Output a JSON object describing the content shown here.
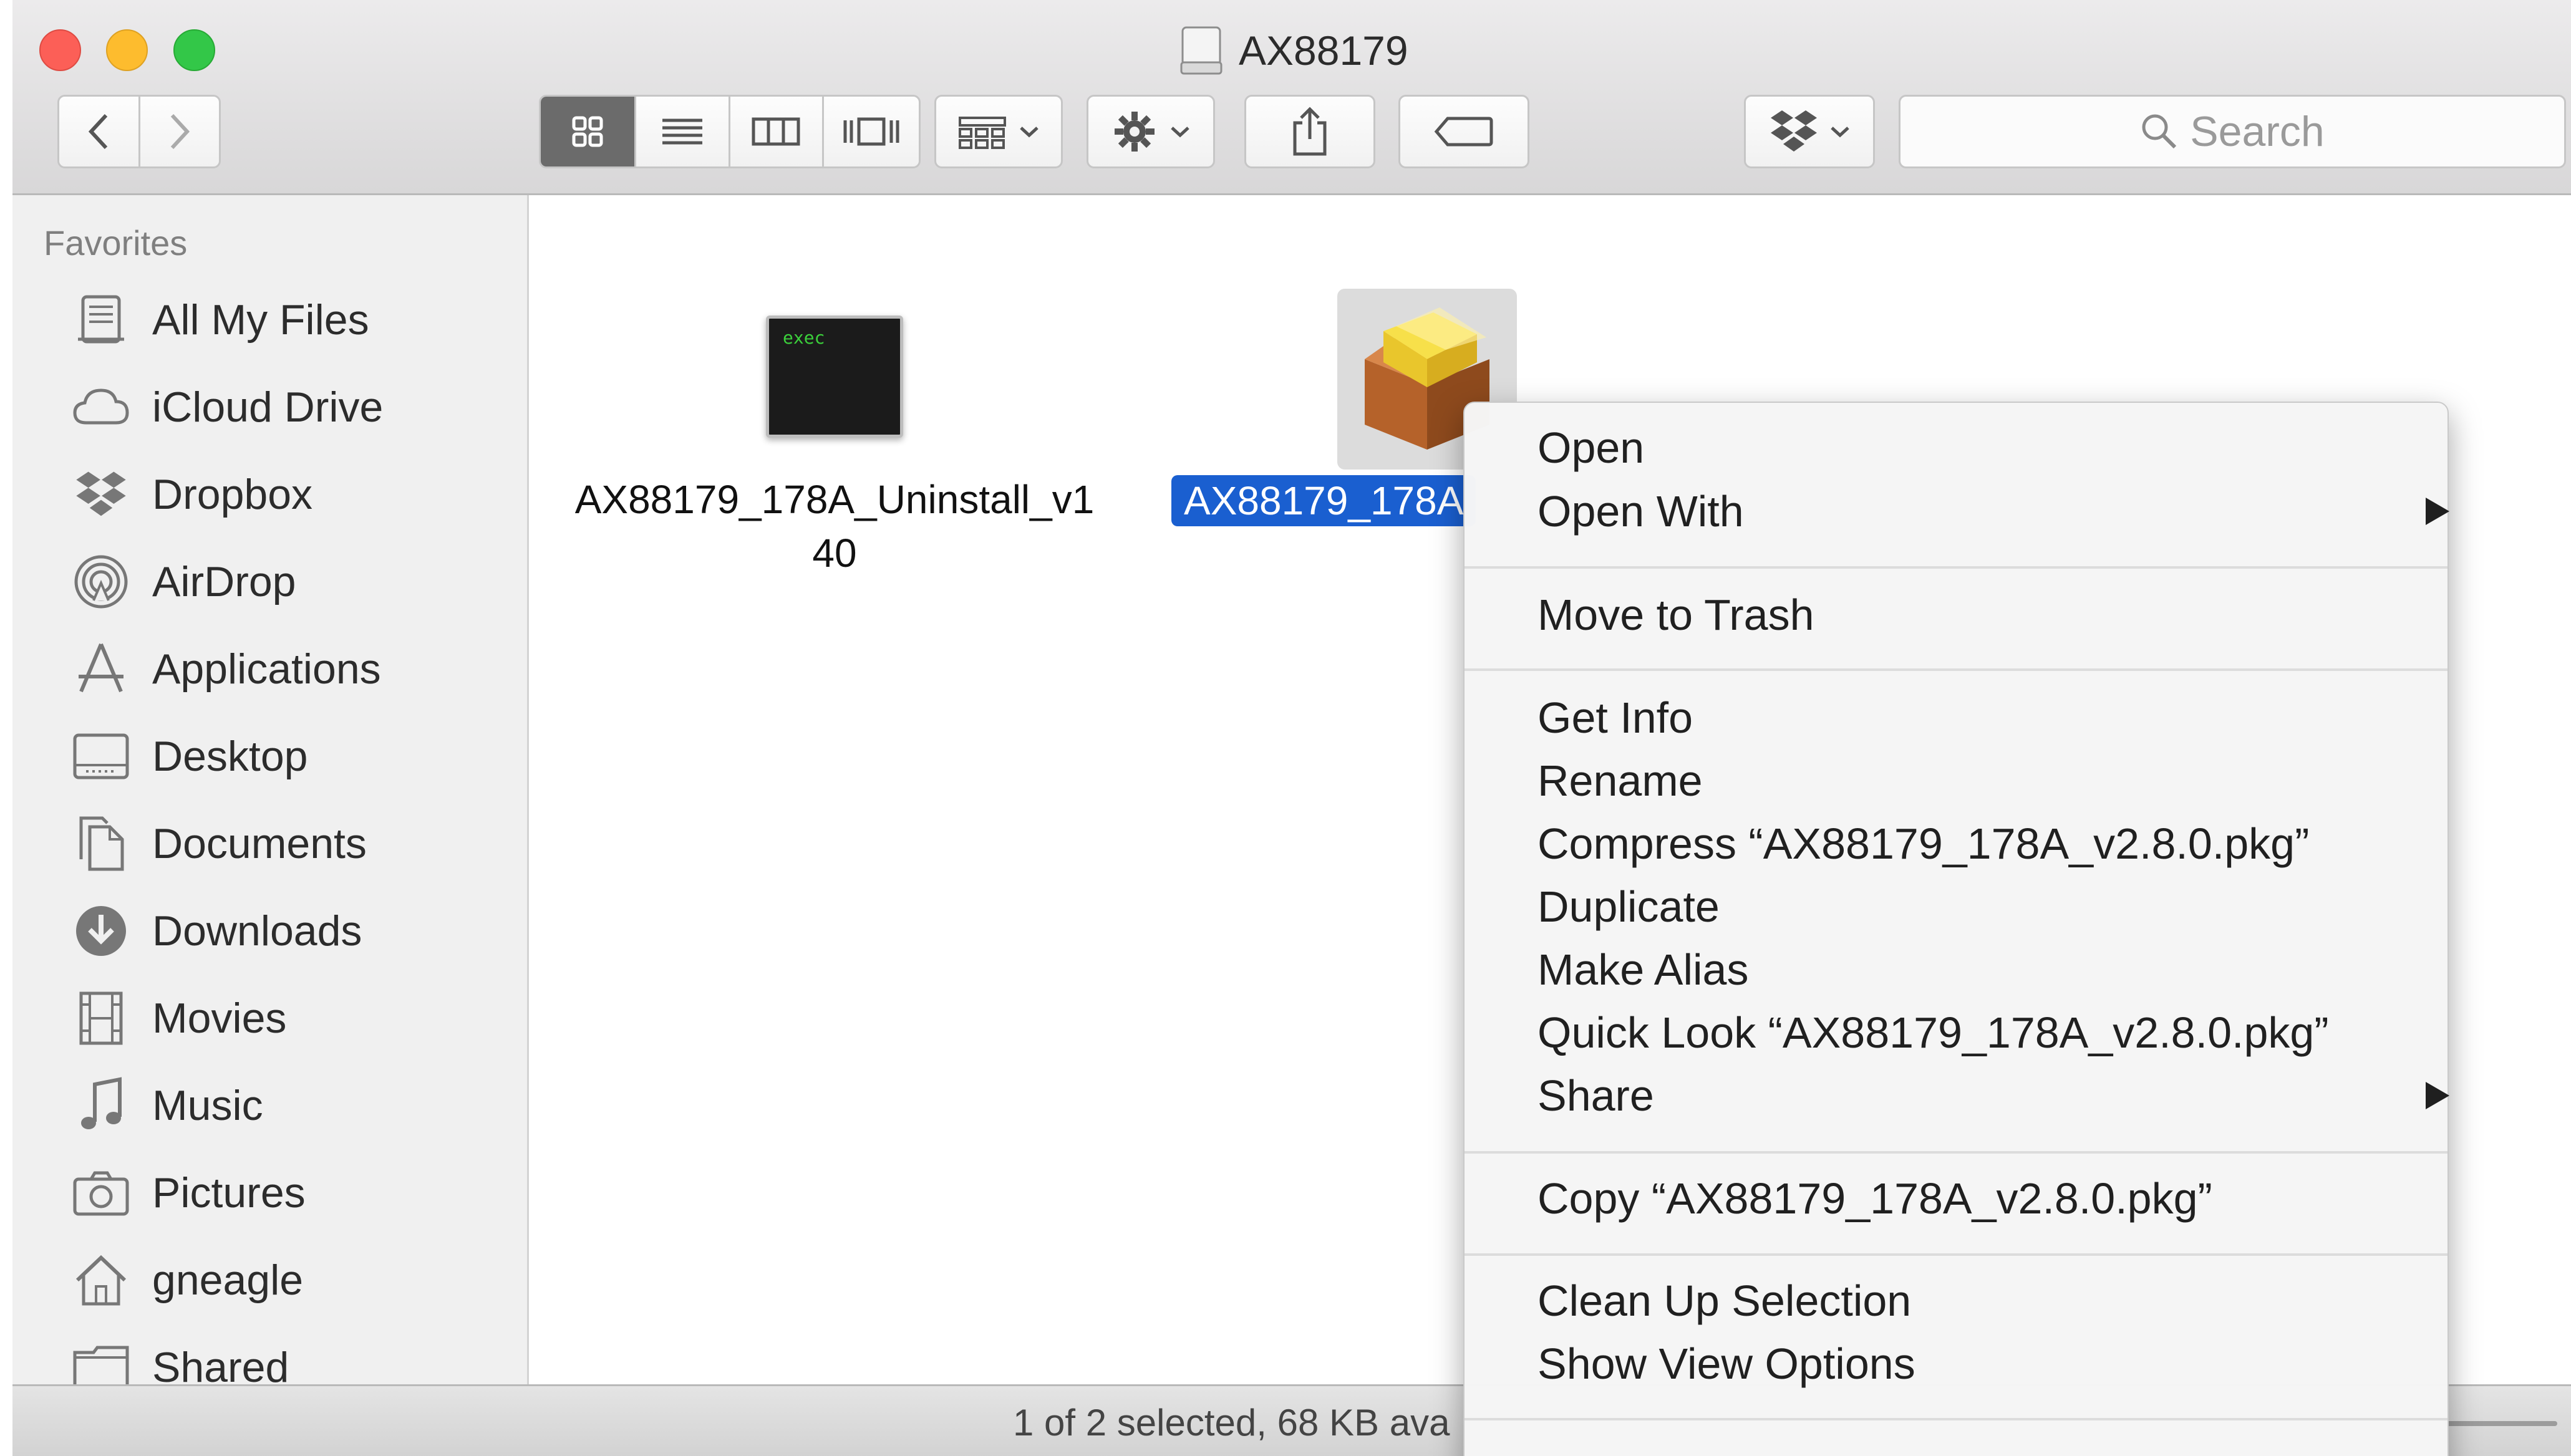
{
  "window": {
    "title": "AX88179"
  },
  "toolbar": {
    "view_modes": [
      "icon-view",
      "list-view",
      "column-view",
      "cover-flow-view"
    ],
    "search_placeholder": "Search"
  },
  "sidebar": {
    "heading": "Favorites",
    "items": [
      {
        "label": "All My Files",
        "icon": "all-my-files-icon"
      },
      {
        "label": "iCloud Drive",
        "icon": "cloud-icon"
      },
      {
        "label": "Dropbox",
        "icon": "dropbox-icon"
      },
      {
        "label": "AirDrop",
        "icon": "airdrop-icon"
      },
      {
        "label": "Applications",
        "icon": "applications-icon"
      },
      {
        "label": "Desktop",
        "icon": "desktop-icon"
      },
      {
        "label": "Documents",
        "icon": "documents-icon"
      },
      {
        "label": "Downloads",
        "icon": "downloads-icon"
      },
      {
        "label": "Movies",
        "icon": "movies-icon"
      },
      {
        "label": "Music",
        "icon": "music-icon"
      },
      {
        "label": "Pictures",
        "icon": "pictures-icon"
      },
      {
        "label": "gneagle",
        "icon": "home-icon"
      },
      {
        "label": "Shared",
        "icon": "folder-icon"
      }
    ]
  },
  "files": [
    {
      "line1": "AX88179_178A_Uninstall_v1",
      "line2": "40",
      "icon": "exec-icon",
      "icon_text": "exec"
    },
    {
      "label": "AX88179_178A",
      "icon": "package-icon",
      "selected": true
    }
  ],
  "status_bar": {
    "text": "1 of 2 selected, 68 KB ava"
  },
  "context_menu": {
    "items": {
      "open": "Open",
      "open_with": "Open With",
      "move_to_trash": "Move to Trash",
      "get_info": "Get Info",
      "rename": "Rename",
      "compress": "Compress “AX88179_178A_v2.8.0.pkg”",
      "duplicate": "Duplicate",
      "make_alias": "Make Alias",
      "quick_look": "Quick Look “AX88179_178A_v2.8.0.pkg”",
      "share": "Share",
      "copy": "Copy “AX88179_178A_v2.8.0.pkg”",
      "clean_up_selection": "Clean Up Selection",
      "show_view_options": "Show View Options"
    }
  },
  "colors": {
    "selection": "#1a5fd0",
    "close": "#fc5f57",
    "minimize": "#fdbc2e",
    "zoom": "#33c748"
  }
}
